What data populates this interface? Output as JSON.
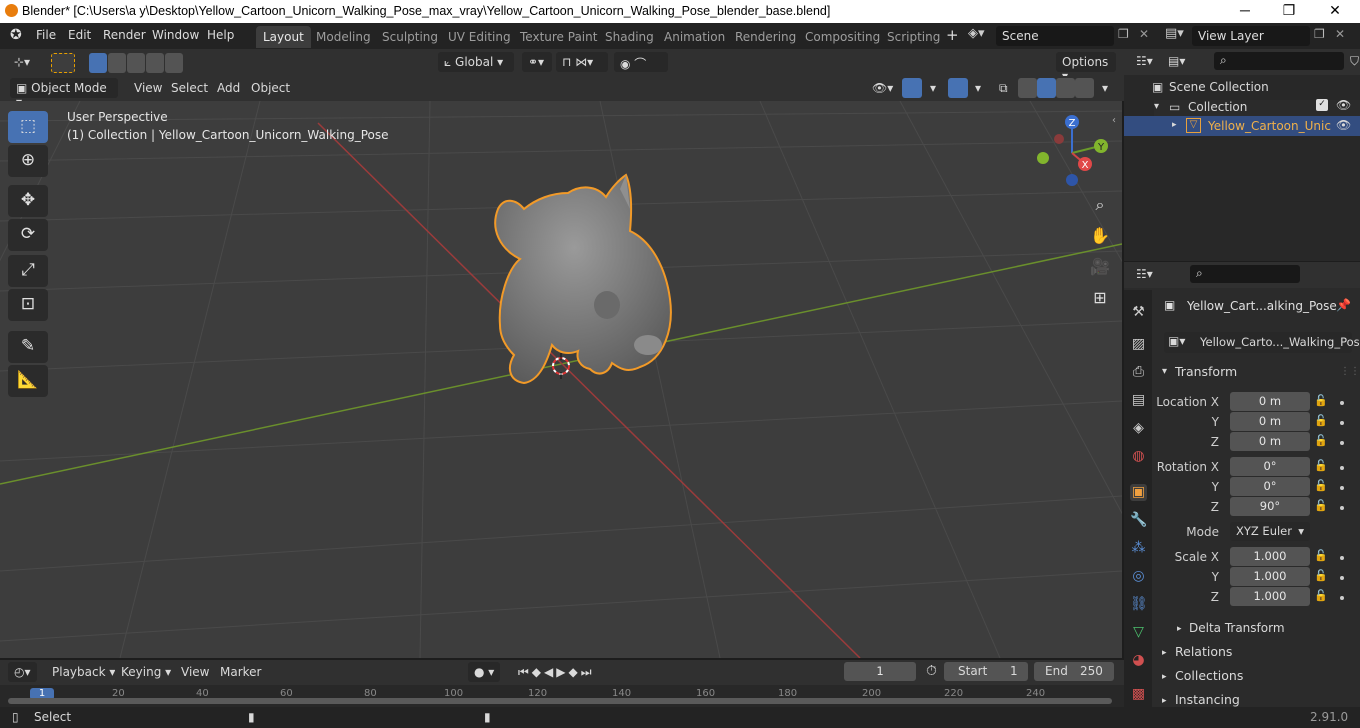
{
  "window": {
    "title": "Blender* [C:\\Users\\a y\\Desktop\\Yellow_Cartoon_Unicorn_Walking_Pose_max_vray\\Yellow_Cartoon_Unicorn_Walking_Pose_blender_base.blend]",
    "minimize": "─",
    "maximize": "❐",
    "close": "✕"
  },
  "menubar": {
    "items": [
      "File",
      "Edit",
      "Render",
      "Window",
      "Help"
    ]
  },
  "workspaces": {
    "tabs": [
      "Layout",
      "Modeling",
      "Sculpting",
      "UV Editing",
      "Texture Paint",
      "Shading",
      "Animation",
      "Rendering",
      "Compositing",
      "Scripting"
    ],
    "active": "Layout",
    "add": "+"
  },
  "scene": {
    "name": "Scene",
    "view_layer": "View Layer"
  },
  "toolbar": {
    "orientation": "Global",
    "options": "Options"
  },
  "viewport_header": {
    "mode": "Object Mode",
    "menus": [
      "View",
      "Select",
      "Add",
      "Object"
    ]
  },
  "viewport": {
    "perspective": "User Perspective",
    "collection_info": "(1) Collection | Yellow_Cartoon_Unicorn_Walking_Pose"
  },
  "gizmo": {
    "x": "X",
    "y": "Y",
    "z": "Z"
  },
  "outliner": {
    "scene_collection": "Scene Collection",
    "collection": "Collection",
    "object": "Yellow_Cartoon_Unic"
  },
  "properties": {
    "object_name": "Yellow_Cart...alking_Pose",
    "data_name": "Yellow_Carto..._Walking_Pose",
    "transform_label": "Transform",
    "location": {
      "label": "Location X",
      "x": "0 m",
      "y": "0 m",
      "z": "0 m"
    },
    "rotation": {
      "label": "Rotation X",
      "x": "0°",
      "y": "0°",
      "z": "90°"
    },
    "mode": {
      "label": "Mode",
      "value": "XYZ Euler"
    },
    "scale": {
      "label": "Scale X",
      "x": "1.000",
      "y": "1.000",
      "z": "1.000"
    },
    "axis_y": "Y",
    "axis_z": "Z",
    "delta": "Delta Transform",
    "relations": "Relations",
    "collections": "Collections",
    "instancing": "Instancing"
  },
  "timeline": {
    "menus": [
      "Playback",
      "Keying",
      "View",
      "Marker"
    ],
    "current_frame": "1",
    "start_label": "Start",
    "start": "1",
    "end_label": "End",
    "end": "250",
    "ruler": [
      "1",
      "20",
      "40",
      "60",
      "80",
      "100",
      "120",
      "140",
      "160",
      "180",
      "200",
      "220",
      "240"
    ]
  },
  "statusbar": {
    "left": "Select",
    "version": "2.91.0"
  }
}
